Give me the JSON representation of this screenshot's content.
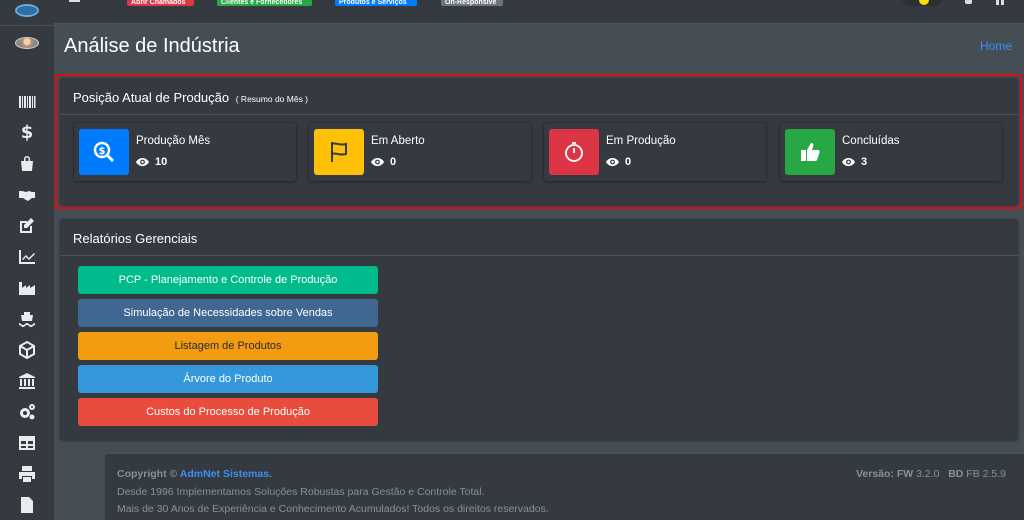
{
  "topbar": {
    "tabs": [
      "Abrir Chamados",
      "Clientes e Fornecedores",
      "Produtos e Serviços",
      "On-Responsive"
    ]
  },
  "sidebar": {
    "items": [
      {
        "icon": "barcode-icon"
      },
      {
        "icon": "dollar-icon",
        "glyph": "$"
      },
      {
        "icon": "shopping-bag-icon"
      },
      {
        "icon": "handshake-icon"
      },
      {
        "icon": "edit-icon"
      },
      {
        "icon": "line-chart-icon"
      },
      {
        "icon": "industry-icon"
      },
      {
        "icon": "ship-icon"
      },
      {
        "icon": "cube-icon"
      },
      {
        "icon": "bank-icon"
      },
      {
        "icon": "cogs-icon"
      },
      {
        "icon": "table-icon"
      },
      {
        "icon": "print-icon"
      },
      {
        "icon": "file-icon"
      }
    ]
  },
  "header": {
    "title": "Análise de Indústria",
    "breadcrumb_home": "Home"
  },
  "production": {
    "title": "Posição Atual de Produção",
    "subtitle": "( Resumo do Mês )",
    "boxes": [
      {
        "label": "Produção Mês",
        "count": "10",
        "icon": "search-dollar-icon",
        "color": "#007bff"
      },
      {
        "label": "Em Aberto",
        "count": "0",
        "icon": "flag-icon",
        "color": "#ffc107"
      },
      {
        "label": "Em Produção",
        "count": "0",
        "icon": "stopwatch-icon",
        "color": "#dc3545"
      },
      {
        "label": "Concluídas",
        "count": "3",
        "icon": "thumbs-up-icon",
        "color": "#28a745"
      }
    ]
  },
  "reports": {
    "title": "Relatórios Gerenciais",
    "buttons": [
      {
        "label": "PCP - Planejamento e Controle de Produção",
        "color": "#00bc8c"
      },
      {
        "label": "Simulação de Necessidades sobre Vendas",
        "color": "#3f6791"
      },
      {
        "label": "Listagem de Produtos",
        "color": "#f39c12"
      },
      {
        "label": "Árvore do Produto",
        "color": "#3498db"
      },
      {
        "label": "Custos do Processo de Produção",
        "color": "#e74c3c"
      }
    ]
  },
  "footer": {
    "copyright_prefix": "Copyright ©",
    "brand": "AdmNet Sistemas",
    "brand_suffix": ".",
    "line2": "Desde 1996 Implementamos Soluções Robustas para Gestão e Controle Total.",
    "line3": "Mais de 30 Anos de Experiência e Conhecimento Acumulados! Todos os direitos reservados.",
    "version_label": "Versão: FW",
    "fw_version": "3.2.0",
    "bd_label": "BD",
    "bd_version": "FB 2.5.9"
  }
}
